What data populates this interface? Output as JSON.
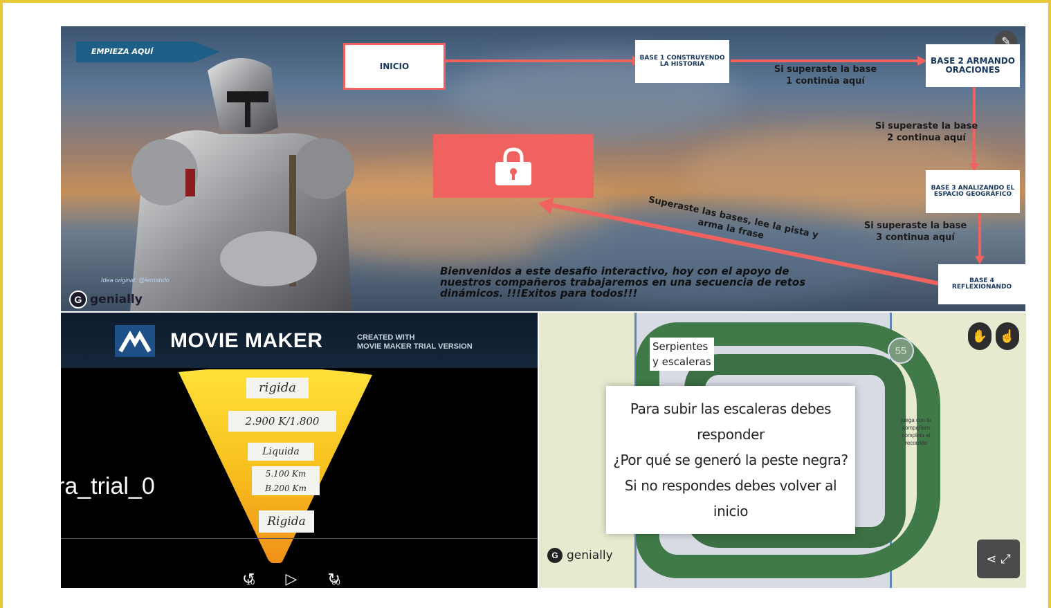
{
  "top_panel": {
    "start_label": "EMPIEZA AQUÍ",
    "boxes": {
      "inicio": "INICIO",
      "base1": "BASE 1 CONSTRUYENDO LA HISTORIA",
      "base2": "BASE 2 ARMANDO ORACIONES",
      "base3": "BASE 3 ANALIZANDO EL ESPACIO GEOGRÁFICO",
      "base4": "BASE 4 REFLEXIONANDO"
    },
    "notes": {
      "after_base1": "Si superaste la base 1 continúa aquí",
      "after_base2": "Si superaste la base 2 continua aquí",
      "after_base3": "Si superaste la base 3 continua aquí",
      "final": "Superaste las bases, lee la pista y arma la frase"
    },
    "welcome": "Bienvenidos a este desafio interactivo, hoy con el apoyo de nuestros compañeros trabajaremos en una secuencia de retos dinámicos. !!!Exitos para todos!!!",
    "idea_credit": "Idea original: @fernando",
    "brand": "genially"
  },
  "movie_maker": {
    "title": "MOVIE MAKER",
    "created_with": "CREATED WITH",
    "trial_version": "MOVIE MAKER TRIAL VERSION",
    "video_label": "ra_trial_0",
    "layer_notes": [
      "rigida",
      "2.900 K/1.800",
      "Liquida",
      "5.100 Km",
      "B.200 Km",
      "Rigida"
    ],
    "rewind_label": "10",
    "forward_label": "30"
  },
  "game": {
    "board_title_line1": "Serpientes",
    "board_title_line2": "y escaleras",
    "dialog_lines": [
      "Para subir las escaleras debes",
      "responder",
      "¿Por qué se generó la peste negra?",
      "Si no respondes debes volver al inicio"
    ],
    "side_note": "juega con tu compañero completa el recorrido",
    "square_number": "55",
    "brand": "genially"
  }
}
